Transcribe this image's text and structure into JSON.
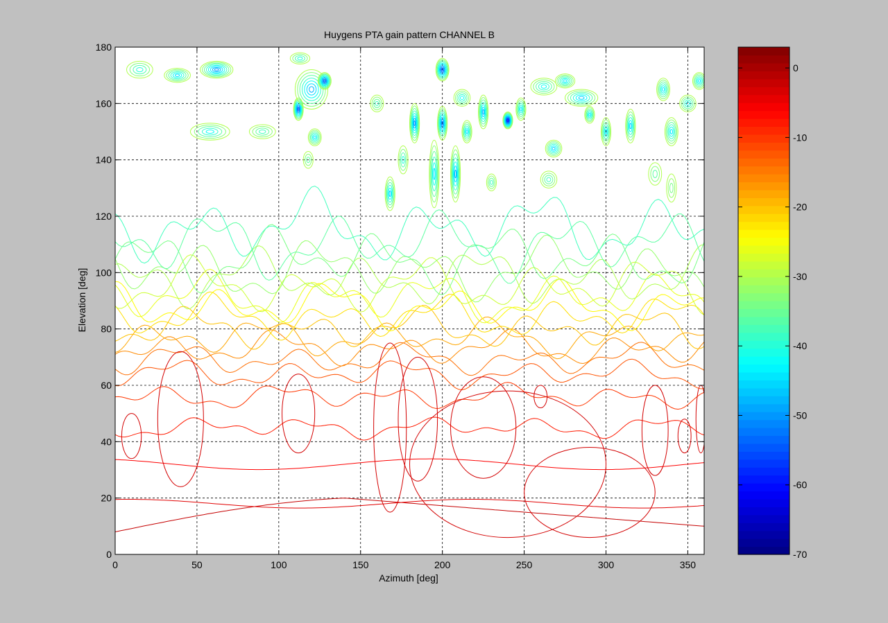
{
  "chart_data": {
    "type": "contour",
    "title": "Huygens PTA gain pattern CHANNEL B",
    "xlabel": "Azimuth [deg]",
    "ylabel": "Elevation [deg]",
    "xlim": [
      0,
      360
    ],
    "ylim": [
      0,
      180
    ],
    "xticks": [
      0,
      50,
      100,
      150,
      200,
      250,
      300,
      350
    ],
    "yticks": [
      0,
      20,
      40,
      60,
      80,
      100,
      120,
      140,
      160,
      180
    ],
    "grid": true,
    "colormap": "jet",
    "colorbar": {
      "range": [
        -70,
        3
      ],
      "ticks": [
        0,
        -10,
        -20,
        -30,
        -40,
        -50,
        -60,
        -70
      ]
    },
    "contour_levels": {
      "start": -2,
      "stop": -38,
      "step": -2,
      "base_elevation": [
        8,
        18,
        32,
        45,
        56,
        64,
        69,
        73,
        77,
        80,
        84,
        88,
        91,
        95,
        98,
        101,
        105,
        110,
        116
      ]
    },
    "closed_contours": [
      {
        "az": 10,
        "el": 42,
        "w": 6,
        "h": 8,
        "level": -3
      },
      {
        "az": 40,
        "el": 48,
        "w": 14,
        "h": 24,
        "level": -3
      },
      {
        "az": 112,
        "el": 50,
        "w": 10,
        "h": 14,
        "level": -3
      },
      {
        "az": 168,
        "el": 45,
        "w": 10,
        "h": 30,
        "level": -3
      },
      {
        "az": 185,
        "el": 48,
        "w": 12,
        "h": 22,
        "level": -3
      },
      {
        "az": 260,
        "el": 56,
        "w": 4,
        "h": 4,
        "level": -3
      },
      {
        "az": 225,
        "el": 45,
        "w": 20,
        "h": 18,
        "level": -3
      },
      {
        "az": 240,
        "el": 32,
        "w": 60,
        "h": 26,
        "level": -3
      },
      {
        "az": 290,
        "el": 22,
        "w": 40,
        "h": 16,
        "level": -3
      },
      {
        "az": 330,
        "el": 44,
        "w": 8,
        "h": 16,
        "level": -3
      },
      {
        "az": 348,
        "el": 42,
        "w": 4,
        "h": 6,
        "level": -3
      },
      {
        "az": 358,
        "el": 48,
        "w": 3,
        "h": 12,
        "level": -3
      }
    ],
    "blobs": [
      {
        "az": 62,
        "el": 172,
        "w": 10,
        "h": 3,
        "level": -50
      },
      {
        "az": 38,
        "el": 170,
        "w": 8,
        "h": 2.5,
        "level": -45
      },
      {
        "az": 15,
        "el": 172,
        "w": 8,
        "h": 3,
        "level": -40
      },
      {
        "az": 58,
        "el": 150,
        "w": 12,
        "h": 3,
        "level": -42
      },
      {
        "az": 90,
        "el": 150,
        "w": 8,
        "h": 2.5,
        "level": -38
      },
      {
        "az": 112,
        "el": 158,
        "w": 3,
        "h": 4,
        "level": -55
      },
      {
        "az": 120,
        "el": 165,
        "w": 10,
        "h": 7,
        "level": -48
      },
      {
        "az": 122,
        "el": 148,
        "w": 4,
        "h": 3,
        "level": -44
      },
      {
        "az": 128,
        "el": 168,
        "w": 4,
        "h": 3,
        "level": -55
      },
      {
        "az": 113,
        "el": 176,
        "w": 6,
        "h": 2,
        "level": -40
      },
      {
        "az": 183,
        "el": 153,
        "w": 3,
        "h": 7,
        "level": -50
      },
      {
        "az": 200,
        "el": 172,
        "w": 4,
        "h": 4,
        "level": -55
      },
      {
        "az": 200,
        "el": 153,
        "w": 3,
        "h": 6,
        "level": -52
      },
      {
        "az": 208,
        "el": 135,
        "w": 3,
        "h": 10,
        "level": -48
      },
      {
        "az": 195,
        "el": 135,
        "w": 3,
        "h": 12,
        "level": -44
      },
      {
        "az": 168,
        "el": 128,
        "w": 3,
        "h": 6,
        "level": -46
      },
      {
        "az": 176,
        "el": 140,
        "w": 3,
        "h": 5,
        "level": -40
      },
      {
        "az": 215,
        "el": 150,
        "w": 3,
        "h": 4,
        "level": -45
      },
      {
        "az": 225,
        "el": 157,
        "w": 3,
        "h": 6,
        "level": -48
      },
      {
        "az": 240,
        "el": 154,
        "w": 3,
        "h": 3,
        "level": -60
      },
      {
        "az": 248,
        "el": 158,
        "w": 3,
        "h": 4,
        "level": -44
      },
      {
        "az": 212,
        "el": 162,
        "w": 5,
        "h": 3,
        "level": -42
      },
      {
        "az": 230,
        "el": 132,
        "w": 3,
        "h": 3,
        "level": -38
      },
      {
        "az": 262,
        "el": 166,
        "w": 8,
        "h": 3,
        "level": -42
      },
      {
        "az": 275,
        "el": 168,
        "w": 6,
        "h": 2.5,
        "level": -44
      },
      {
        "az": 285,
        "el": 162,
        "w": 10,
        "h": 3,
        "level": -46
      },
      {
        "az": 268,
        "el": 144,
        "w": 5,
        "h": 3,
        "level": -46
      },
      {
        "az": 265,
        "el": 133,
        "w": 5,
        "h": 3,
        "level": -38
      },
      {
        "az": 290,
        "el": 156,
        "w": 3,
        "h": 3,
        "level": -44
      },
      {
        "az": 300,
        "el": 150,
        "w": 3,
        "h": 5,
        "level": -44
      },
      {
        "az": 315,
        "el": 152,
        "w": 3,
        "h": 6,
        "level": -46
      },
      {
        "az": 335,
        "el": 165,
        "w": 4,
        "h": 4,
        "level": -44
      },
      {
        "az": 340,
        "el": 150,
        "w": 4,
        "h": 5,
        "level": -44
      },
      {
        "az": 350,
        "el": 160,
        "w": 5,
        "h": 3,
        "level": -42
      },
      {
        "az": 357,
        "el": 168,
        "w": 4,
        "h": 3,
        "level": -44
      },
      {
        "az": 160,
        "el": 160,
        "w": 4,
        "h": 3,
        "level": -38
      },
      {
        "az": 118,
        "el": 140,
        "w": 3,
        "h": 3,
        "level": -36
      },
      {
        "az": 330,
        "el": 135,
        "w": 4,
        "h": 4,
        "level": -36
      },
      {
        "az": 340,
        "el": 130,
        "w": 3,
        "h": 5,
        "level": -34
      }
    ]
  }
}
